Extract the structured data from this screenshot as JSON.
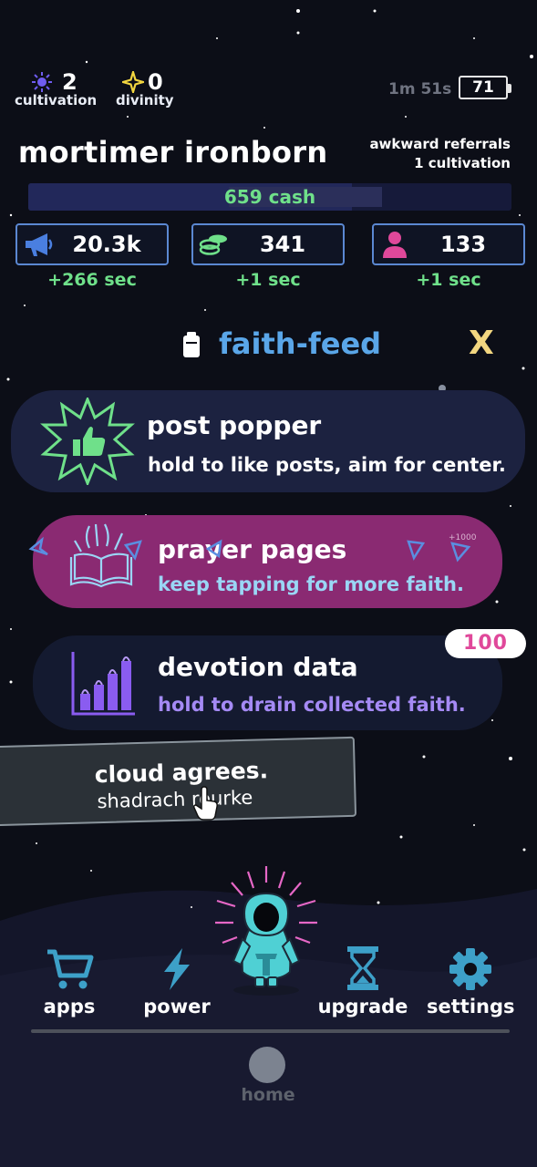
{
  "stats": {
    "cultivation": {
      "value": "2",
      "label": "cultivation"
    },
    "divinity": {
      "value": "0",
      "label": "divinity"
    },
    "timer": "1m 51s",
    "battery": "71"
  },
  "player": {
    "name": "mortimer ironborn",
    "referral_line1": "awkward referrals",
    "referral_line2": "1 cultivation"
  },
  "cash": {
    "label": "659 cash",
    "progress": 0.67
  },
  "resources": [
    {
      "icon": "megaphone-icon",
      "value": "20.3k",
      "rate": "+266 sec"
    },
    {
      "icon": "coins-icon",
      "value": "341",
      "rate": "+1 sec"
    },
    {
      "icon": "person-icon",
      "value": "133",
      "rate": "+1 sec"
    }
  ],
  "feed": {
    "title": "faith-feed",
    "close": "X"
  },
  "cards": [
    {
      "title": "post popper",
      "subtitle": "hold to like posts, aim for center."
    },
    {
      "title": "prayer pages",
      "subtitle": "keep tapping for more faith.",
      "popup": "+1000"
    },
    {
      "title": "devotion data",
      "subtitle": "hold to drain collected faith.",
      "badge": "100"
    }
  ],
  "toast": {
    "message": "cloud agrees.",
    "author": "shadrach rourke"
  },
  "nav": {
    "apps": "apps",
    "power": "power",
    "upgrade": "upgrade",
    "settings": "settings",
    "home": "home"
  },
  "colors": {
    "background": "#0c0e17",
    "accent_blue": "#5aa6e8",
    "accent_green": "#6fe08a",
    "accent_pink": "#e0489a",
    "card_purple": "#8a2a72",
    "card_navy": "#1c2240",
    "nav_icon": "#3da0c8",
    "close_yellow": "#f2d680"
  }
}
